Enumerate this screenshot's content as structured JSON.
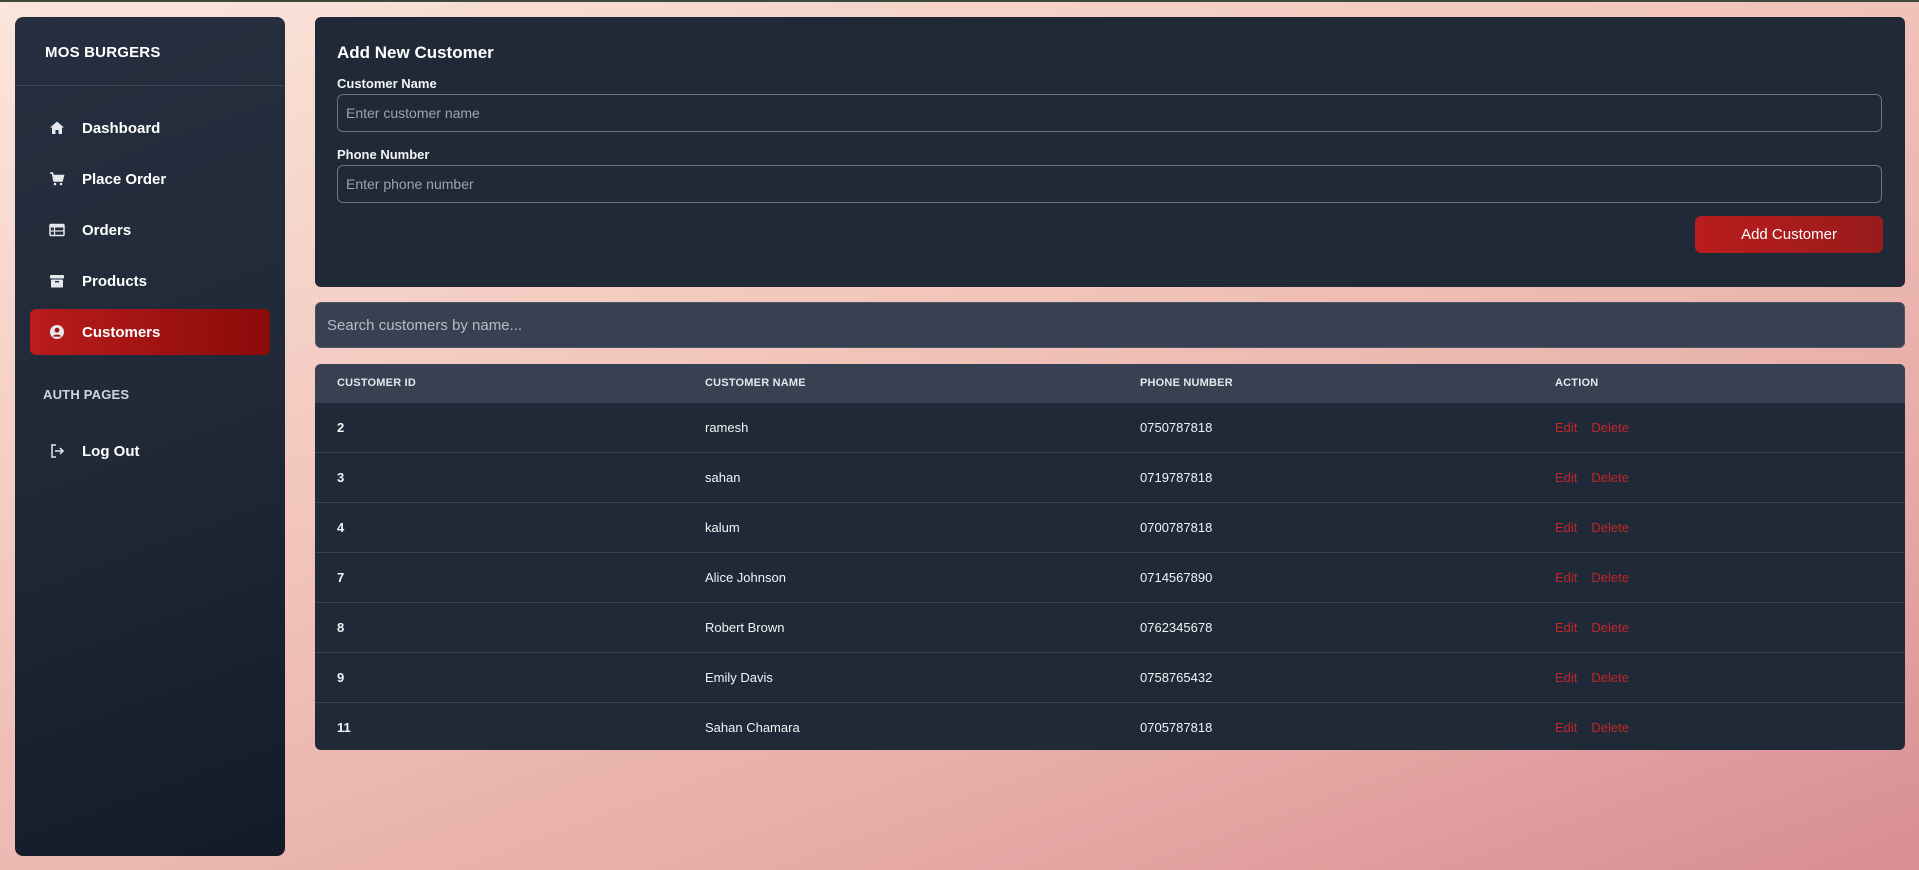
{
  "sidebar": {
    "brand": "MOS BURGERS",
    "items": [
      {
        "label": "Dashboard",
        "icon": "home-icon"
      },
      {
        "label": "Place Order",
        "icon": "cart-icon"
      },
      {
        "label": "Orders",
        "icon": "table-icon"
      },
      {
        "label": "Products",
        "icon": "archive-icon"
      },
      {
        "label": "Customers",
        "icon": "user-circle-icon"
      }
    ],
    "active_item": "Customers",
    "section_title": "AUTH PAGES",
    "logout_label": "Log Out"
  },
  "form": {
    "title": "Add New Customer",
    "name_label": "Customer Name",
    "name_placeholder": "Enter customer name",
    "phone_label": "Phone Number",
    "phone_placeholder": "Enter phone number",
    "submit_label": "Add Customer"
  },
  "search": {
    "placeholder": "Search customers by name..."
  },
  "table": {
    "columns": [
      "CUSTOMER ID",
      "CUSTOMER NAME",
      "PHONE NUMBER",
      "ACTION"
    ],
    "rows": [
      {
        "id": "2",
        "name": "ramesh",
        "phone": "0750787818"
      },
      {
        "id": "3",
        "name": "sahan",
        "phone": "0719787818"
      },
      {
        "id": "4",
        "name": "kalum",
        "phone": "0700787818"
      },
      {
        "id": "7",
        "name": "Alice Johnson",
        "phone": "0714567890"
      },
      {
        "id": "8",
        "name": "Robert Brown",
        "phone": "0762345678"
      },
      {
        "id": "9",
        "name": "Emily Davis",
        "phone": "0758765432"
      },
      {
        "id": "11",
        "name": "Sahan Chamara",
        "phone": "0705787818"
      }
    ],
    "edit_label": "Edit",
    "delete_label": "Delete"
  },
  "colors": {
    "accent": "#b91c1c",
    "panel": "#1f2937",
    "action_text": "#c22727"
  }
}
